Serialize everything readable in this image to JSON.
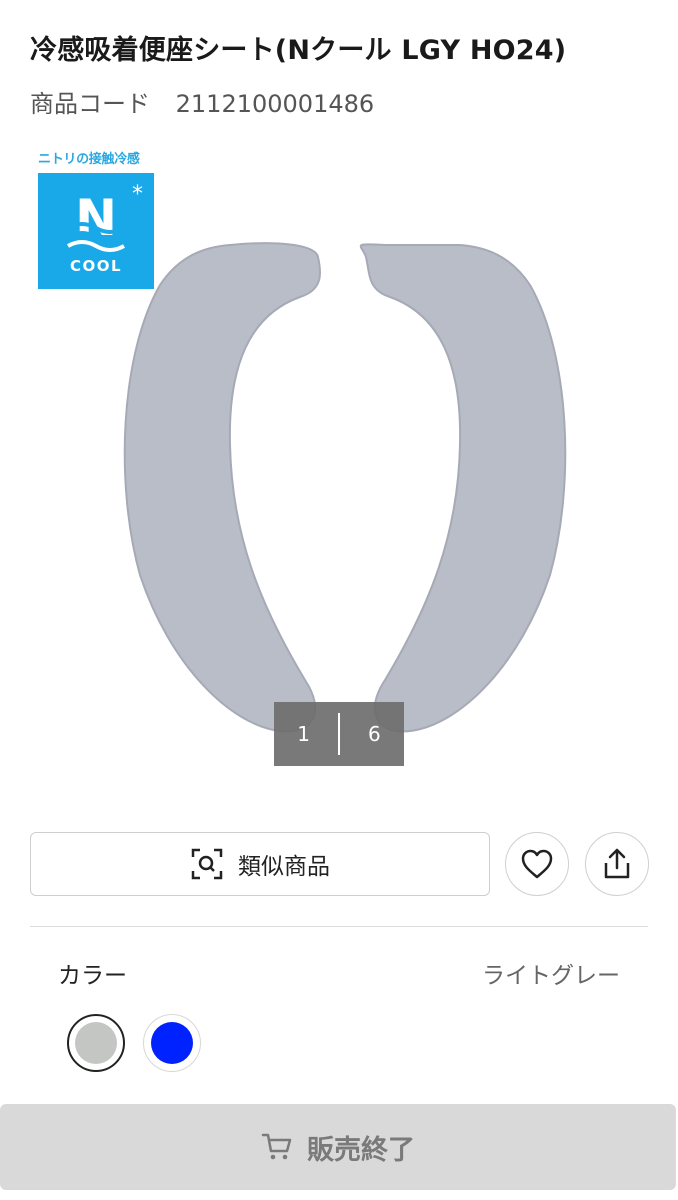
{
  "product": {
    "title": "冷感吸着便座シート(Nクール LGY HO24)",
    "code_label": "商品コード",
    "code_value": "2112100001486"
  },
  "badge": {
    "caption": "ニトリの接触冷感",
    "logo_letter": "N",
    "logo_text": "COOL",
    "icon": "ncool-logo-icon"
  },
  "gallery": {
    "current": "1",
    "total": "6"
  },
  "actions": {
    "similar_label": "類似商品",
    "similar_icon": "image-search-icon",
    "favorite_icon": "heart-icon",
    "share_icon": "share-icon"
  },
  "color": {
    "label": "カラー",
    "selected": "ライトグレー",
    "swatches": [
      {
        "name": "light-gray",
        "hex": "#c4c6c4"
      },
      {
        "name": "blue",
        "hex": "#0022ff"
      }
    ]
  },
  "cart": {
    "label": "販売終了",
    "icon": "cart-icon"
  },
  "colors": {
    "seat": "#b9bdc8",
    "badge_bg": "#1aa9e8",
    "soldout_bg": "#d9d9d9"
  }
}
